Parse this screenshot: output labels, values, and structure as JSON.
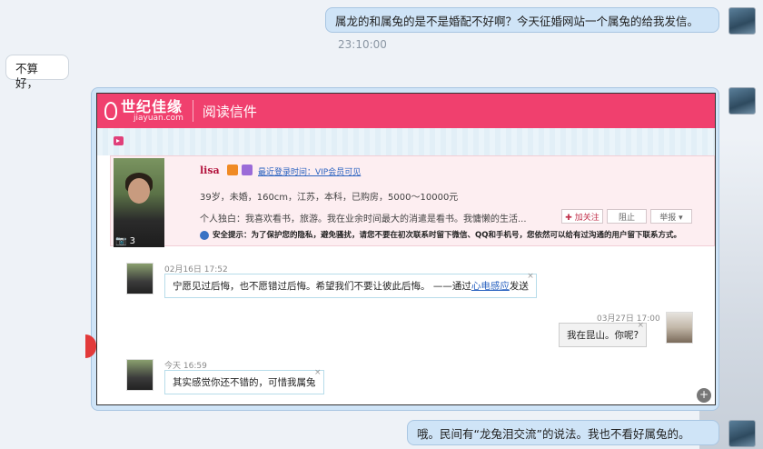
{
  "chat": {
    "msg1": "属龙的和属兔的是不是婚配不好啊？今天征婚网站一个属兔的给我发信。",
    "timestamp": "23:10:00",
    "msg2": "不算好，",
    "msg3": "哦。民间有“龙兔泪交流”的说法。我也不看好属兔的。"
  },
  "card": {
    "logo_main": "世纪佳缘",
    "logo_sub": "jiayuan.com",
    "header_title": "阅读信件",
    "profile": {
      "name": "lisa",
      "last_login": "最近登录时间：VIP会员可见",
      "info": "39岁，未婚，160cm，江苏，本科，已购房，5000～10000元",
      "bio": "个人独白：我喜欢看书，旅游。我在业余时间最大的消遣是看书。我慵懒的生活...",
      "photo_count": "3",
      "btn_follow": "✚ 加关注",
      "btn_block": "阻止",
      "btn_report": "举报 ▾",
      "safety": "安全提示：为了保护您的隐私，避免骚扰，请您不要在初次联系时留下微信、QQ和手机号，您依然可以给有过沟通的用户留下联系方式。"
    },
    "conversation": {
      "m1_time": "02月16日  17:52",
      "m1_text": "宁愿见过后悔，也不愿错过后悔。希望我们不要让彼此后悔。  ——通过",
      "m1_link": "心电感应",
      "m1_suffix": "发送",
      "m2_time": "03月27日  17:00",
      "m2_text": "我在昆山。你呢?",
      "m3_time": "今天  16:59",
      "m3_text": "其实感觉你还不错的，可惜我属兔",
      "close": "×"
    }
  }
}
